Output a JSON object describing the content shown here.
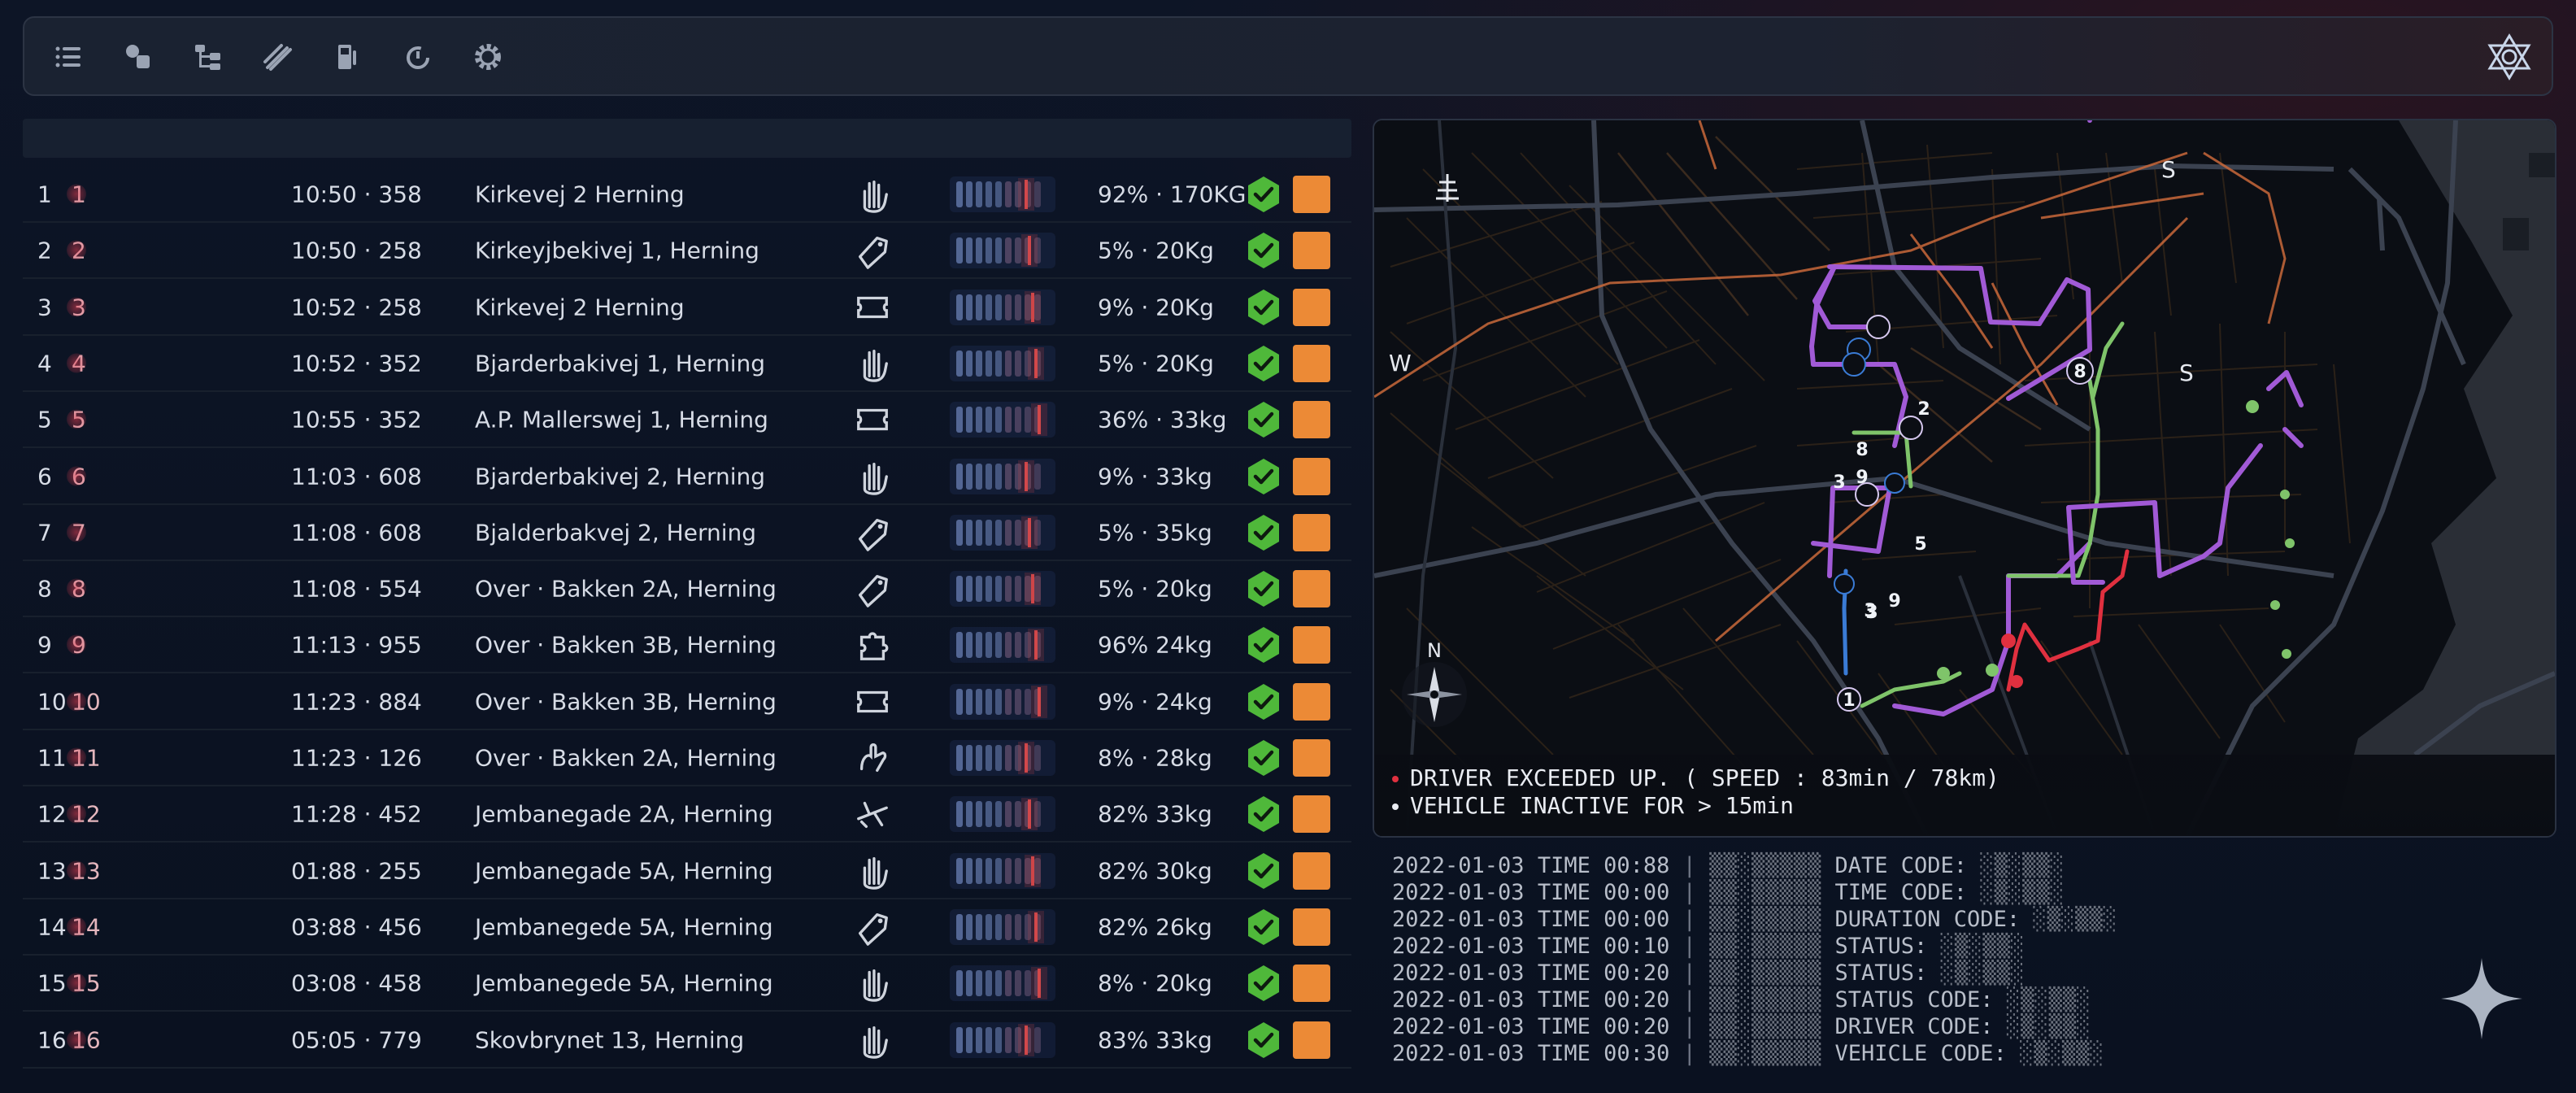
{
  "toolbar": {
    "icons": [
      "list-icon",
      "shapes-icon",
      "hierarchy-icon",
      "tools-icon",
      "fuel-pump-icon",
      "refresh-timer-icon",
      "settings-gear-icon"
    ],
    "logo": "star-of-david-logo"
  },
  "table": {
    "rows": [
      {
        "idx": "1",
        "num": "1",
        "time": "10:50 · 358",
        "address": "Kirkevej 2 Herning",
        "icon": "hand-icon",
        "load": "92% · 170KG"
      },
      {
        "idx": "2",
        "num": "2",
        "time": "10:50 · 258",
        "address": "Kirkeyjbekivej 1, Herning",
        "icon": "tag-icon",
        "load": "5% · 20Kg"
      },
      {
        "idx": "3",
        "num": "3",
        "time": "10:52 · 258",
        "address": "Kirkevej 2 Herning",
        "icon": "ticket-icon",
        "load": "9% · 20Kg"
      },
      {
        "idx": "4",
        "num": "4",
        "time": "10:52 · 352",
        "address": "Bjarderbakivej 1, Herning",
        "icon": "hand-icon",
        "load": "5% · 20Kg"
      },
      {
        "idx": "5",
        "num": "5",
        "time": "10:55 · 352",
        "address": "A.P. Mallerswej 1, Herning",
        "icon": "ticket-icon",
        "load": "36% · 33kg"
      },
      {
        "idx": "6",
        "num": "6",
        "time": "11:03 · 608",
        "address": "Bjarderbakivej 2, Herning",
        "icon": "hand-icon",
        "load": "9% · 33kg"
      },
      {
        "idx": "7",
        "num": "7",
        "time": "11:08 · 608",
        "address": "Bjalderbakvej 2, Herning",
        "icon": "tag-icon",
        "load": "5% · 35kg"
      },
      {
        "idx": "8",
        "num": "8",
        "time": "11:08 · 554",
        "address": "Over · Bakken 2A, Herning",
        "icon": "tag-icon",
        "load": "5% · 20kg"
      },
      {
        "idx": "9",
        "num": "9",
        "time": "11:13 · 955",
        "address": "Over · Bakken 3B, Herning",
        "icon": "puzzle-icon",
        "load": "96% 24kg"
      },
      {
        "idx": "10",
        "num": "10",
        "time": "11:23 · 884",
        "address": "Over · Bakken 3B, Herning",
        "icon": "ticket-icon",
        "load": "9% · 24kg"
      },
      {
        "idx": "11",
        "num": "11",
        "time": "11:23 · 126",
        "address": "Over · Bakken 2A, Herning",
        "icon": "gesture-icon",
        "load": "8% · 28kg"
      },
      {
        "idx": "12",
        "num": "12",
        "time": "11:28 · 452",
        "address": "Jembanegade 2A, Herning",
        "icon": "plane-icon",
        "load": "82% 33kg"
      },
      {
        "idx": "13",
        "num": "13",
        "time": "01:88 · 255",
        "address": "Jembanegade 5A, Herning",
        "icon": "hand-icon",
        "load": "82% 30kg"
      },
      {
        "idx": "14",
        "num": "14",
        "time": "03:88 · 456",
        "address": "Jembanegede 5A, Herning",
        "icon": "tag-icon",
        "load": "82% 26kg"
      },
      {
        "idx": "15",
        "num": "15",
        "time": "03:08 · 458",
        "address": "Jembanegede 5A, Herning",
        "icon": "hand-icon",
        "load": "8% · 20kg"
      },
      {
        "idx": "16",
        "num": "16",
        "time": "05:05 · 779",
        "address": "Skovbrynet 13, Herning",
        "icon": "hand-icon",
        "load": "83% 33kg"
      }
    ]
  },
  "map": {
    "compass_labels": {
      "west": "W",
      "south_top": "S",
      "south_right": "S",
      "north": "N"
    },
    "stop_labels": [
      "8",
      "2",
      "3",
      "9",
      "3",
      "5",
      "3",
      "9",
      "1",
      "8"
    ],
    "route_colors": {
      "purple": "#a15ad6",
      "green": "#7fc46a",
      "red": "#e0303f",
      "blue": "#3a7bd5"
    },
    "alerts": [
      {
        "text": "DRIVER EXCEEDED UP. ( SPEED : 83min / 78km)",
        "dot_color": "#e0303f"
      },
      {
        "text": "VEHICLE INACTIVE FOR > 15min",
        "dot_color": "#e9ecf2"
      }
    ]
  },
  "log": [
    {
      "date": "2022-01-03",
      "time": "TIME 00:88",
      "label": "DATE CODE:"
    },
    {
      "date": "2022-01-03",
      "time": "TIME 00:00",
      "label": "TIME CODE:"
    },
    {
      "date": "2022-01-03",
      "time": "TIME 00:00",
      "label": "DURATION CODE:"
    },
    {
      "date": "2022-01-03",
      "time": "TIME 00:10",
      "label": "STATUS:"
    },
    {
      "date": "2022-01-03",
      "time": "TIME 00:20",
      "label": "STATUS:"
    },
    {
      "date": "2022-01-03",
      "time": "TIME 00:20",
      "label": "STATUS CODE:"
    },
    {
      "date": "2022-01-03",
      "time": "TIME 00:20",
      "label": "DRIVER CODE:"
    },
    {
      "date": "2022-01-03",
      "time": "TIME 00:30",
      "label": "VEHICLE CODE:"
    }
  ],
  "colors": {
    "accent_orange": "#ec8a36",
    "check_green": "#4fb83a",
    "alert_red": "#e0303f"
  },
  "decor": {
    "sparkle": "sparkle-star-icon"
  }
}
